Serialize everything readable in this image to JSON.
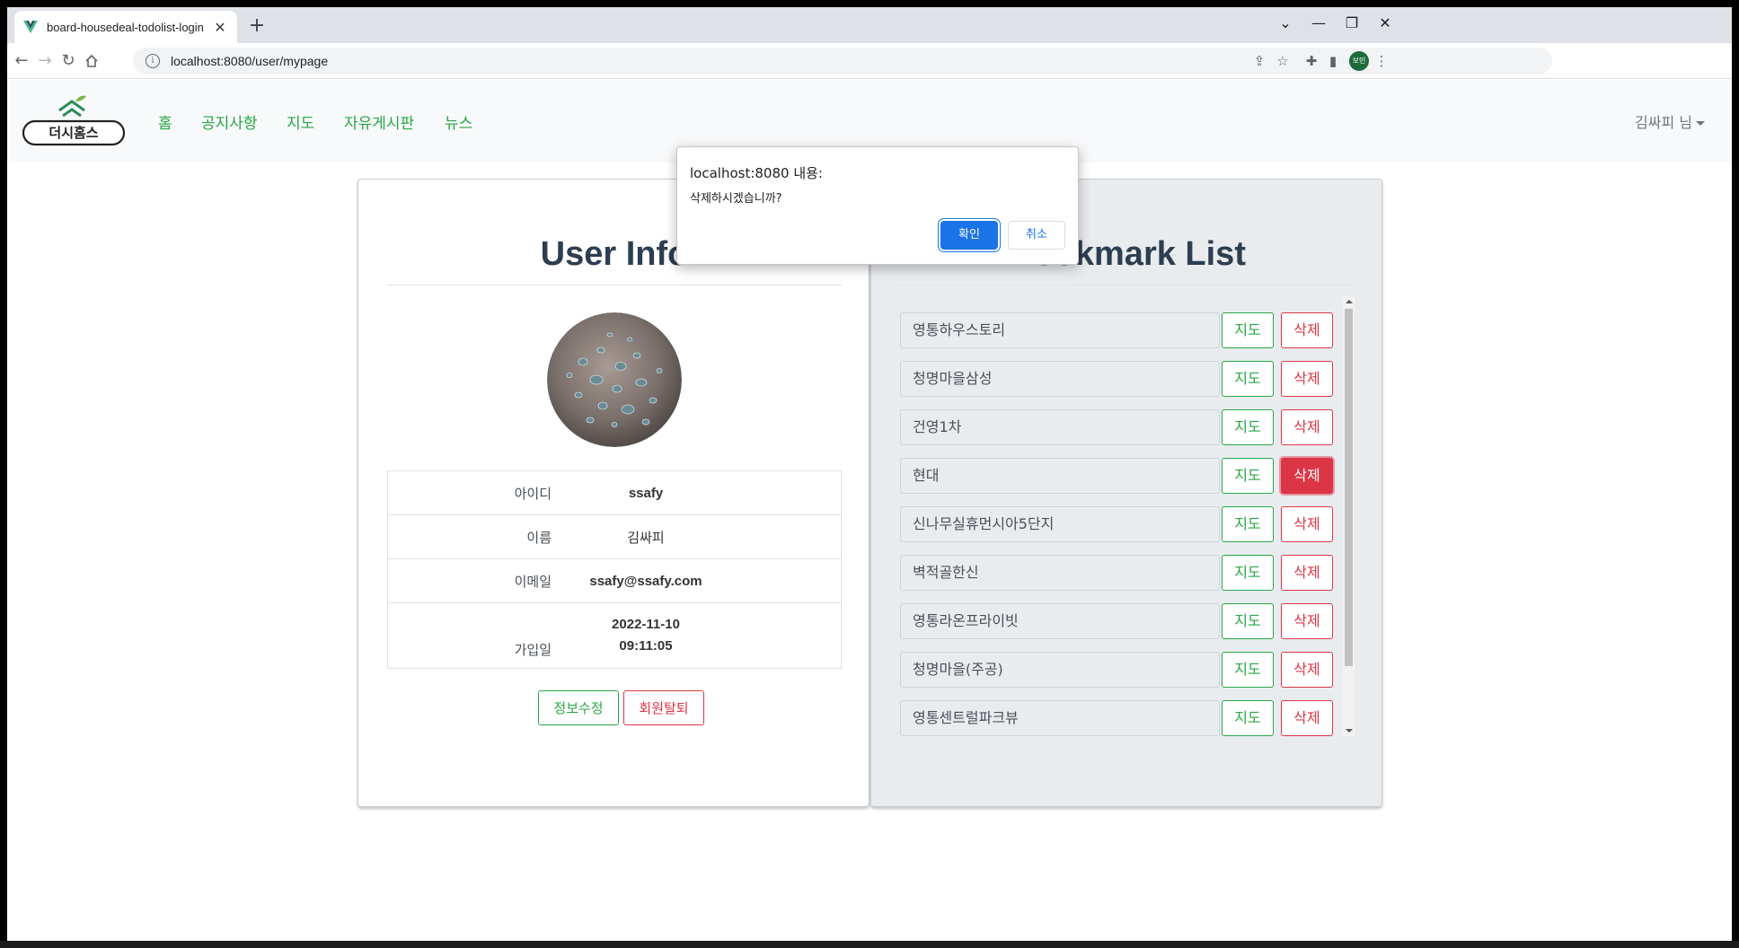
{
  "browser": {
    "tab_title": "board-housedeal-todolist-login",
    "tab_close": "✕",
    "new_tab": "+",
    "url": "localhost:8080/user/mypage",
    "profile_label": "보민",
    "controls": {
      "tablist": "⌄",
      "minimize": "—",
      "restore": "❐",
      "close": "✕"
    }
  },
  "navbar": {
    "logo_text": "더시홈스",
    "links": [
      "홈",
      "공지사항",
      "지도",
      "자유게시판",
      "뉴스"
    ],
    "user_menu": "김싸피 님"
  },
  "user_info": {
    "title": "User Info",
    "rows": [
      {
        "label": "아이디",
        "value": "ssafy"
      },
      {
        "label": "이름",
        "value": "김싸피"
      },
      {
        "label": "이메일",
        "value": "ssafy@ssafy.com"
      },
      {
        "label": "가입일",
        "date": "2022-11-10",
        "time": "09:11:05"
      }
    ],
    "edit_button": "정보수정",
    "withdraw_button": "회원탈퇴"
  },
  "bookmarks": {
    "title": "Bookmark List",
    "map_label": "지도",
    "delete_label": "삭제",
    "items": [
      "영통하우스토리",
      "청명마을삼성",
      "건영1차",
      "현대",
      "신나무실휴먼시아5단지",
      "벽적골한신",
      "영통라온프라이빗",
      "청명마을(주공)",
      "영통센트럴파크뷰"
    ],
    "active_delete_index": 3
  },
  "dialog": {
    "title": "localhost:8080 내용:",
    "message": "삭제하시겠습니까?",
    "ok": "확인",
    "cancel": "취소"
  },
  "colors": {
    "green": "#28a745",
    "red": "#dc3545",
    "dialog_blue": "#1a73e8",
    "heading": "#2c3e50"
  }
}
